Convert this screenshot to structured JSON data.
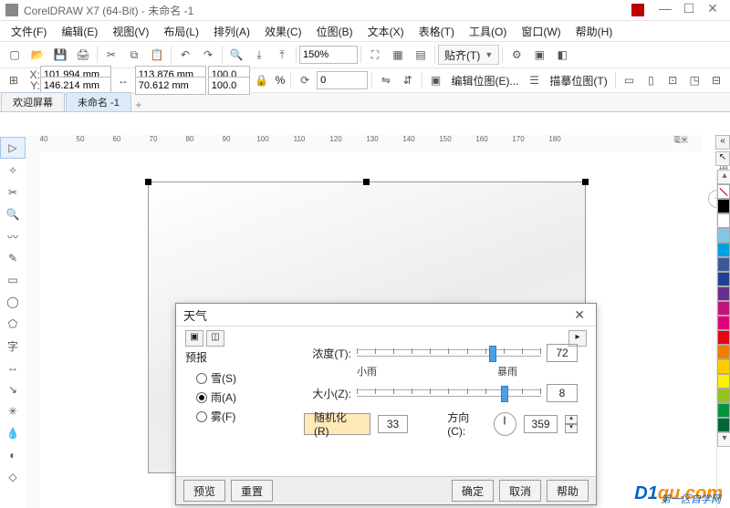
{
  "title": "CorelDRAW X7 (64-Bit) - 未命名 -1",
  "menus": [
    "文件(F)",
    "编辑(E)",
    "视图(V)",
    "布局(L)",
    "排列(A)",
    "效果(C)",
    "位图(B)",
    "文本(X)",
    "表格(T)",
    "工具(O)",
    "窗口(W)",
    "帮助(H)"
  ],
  "toolbar": {
    "zoom": "150%",
    "snap_label": "贴齐(T)"
  },
  "prop": {
    "x_label": "X:",
    "y_label": "Y:",
    "x": "101.994 mm",
    "y": "146.214 mm",
    "w": "113.876 mm",
    "h": "70.612 mm",
    "sx": "100.0",
    "sy": "100.0",
    "rot": "0",
    "edit_bitmap": "编辑位图(E)...",
    "trace_bitmap": "描摹位图(T)"
  },
  "tabs": {
    "welcome": "欢迎屏幕",
    "doc": "未命名 -1"
  },
  "ruler_marks": [
    "40",
    "50",
    "60",
    "70",
    "80",
    "90",
    "100",
    "110",
    "120",
    "130",
    "140",
    "150",
    "160",
    "170",
    "180"
  ],
  "ruler_unit": "毫米",
  "side_label": "提示",
  "palette": [
    "#000000",
    "#ffffff",
    "#82c8e6",
    "#009fe3",
    "#3b5998",
    "#1d3f94",
    "#6b2e8f",
    "#c0157a",
    "#e2007a",
    "#e30613",
    "#ef7d00",
    "#ffcc00",
    "#fff200",
    "#95c11f",
    "#009640",
    "#006633"
  ],
  "dialog": {
    "title": "天气",
    "forecast_label": "预报",
    "opts": {
      "snow": "雪(S)",
      "rain": "雨(A)",
      "fog": "雾(F)"
    },
    "selected": "rain",
    "density_label": "浓度(T):",
    "density_val": "72",
    "scale_small": "小雨",
    "scale_big": "暴雨",
    "size_label": "大小(Z):",
    "size_val": "8",
    "random_btn": "随机化(R)",
    "random_val": "33",
    "dir_label": "方向(C):",
    "dir_val": "359",
    "footer": {
      "preview": "预览",
      "reset": "重置",
      "ok": "确定",
      "cancel": "取消",
      "help": "帮助"
    }
  },
  "watermark": {
    "brand": "D1",
    "domain": "qu.com",
    "sub": "第一区自学网"
  }
}
